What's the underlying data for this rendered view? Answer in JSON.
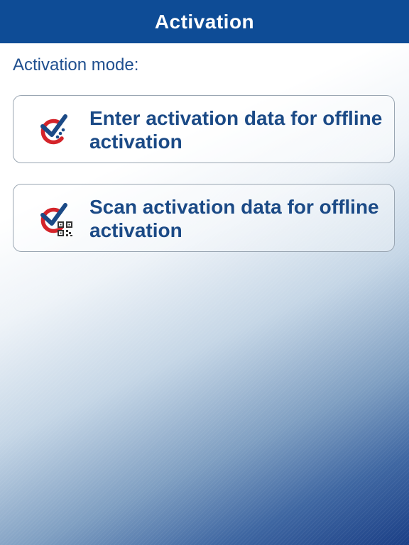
{
  "header": {
    "title": "Activation"
  },
  "main": {
    "mode_label": "Activation mode:",
    "options": [
      {
        "label": "Enter activation data for offline activation",
        "icon": "check-enter-icon"
      },
      {
        "label": "Scan activation data for offline activation",
        "icon": "check-qr-icon"
      }
    ]
  },
  "colors": {
    "header_background": "#0e4c96",
    "text_primary": "#1b4a86",
    "icon_red": "#d4242a",
    "icon_blue": "#1b4a86"
  }
}
